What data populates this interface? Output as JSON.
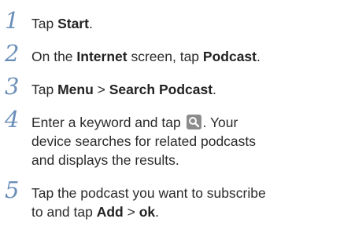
{
  "steps": [
    {
      "number": "1",
      "parts": [
        "Tap ",
        "Start",
        "."
      ]
    },
    {
      "number": "2",
      "parts": [
        "On the ",
        "Internet",
        " screen, tap ",
        "Podcast",
        "."
      ]
    },
    {
      "number": "3",
      "parts": [
        "Tap ",
        "Menu",
        " > ",
        "Search Podcast",
        "."
      ]
    },
    {
      "number": "4",
      "line1_before_icon": "Enter a keyword and tap ",
      "line1_after_icon": ". Your",
      "line2": "device searches for related podcasts",
      "line3": "and displays the results.",
      "icon": "search-icon"
    },
    {
      "number": "5",
      "line1": "Tap the podcast you want to subscribe",
      "line2_parts": [
        "to and tap ",
        "Add",
        " > ",
        "ok",
        "."
      ]
    }
  ],
  "colors": {
    "step_number": "#6b8fb8",
    "text": "#2a2a2a",
    "icon_bg": "#8c8c8c"
  }
}
